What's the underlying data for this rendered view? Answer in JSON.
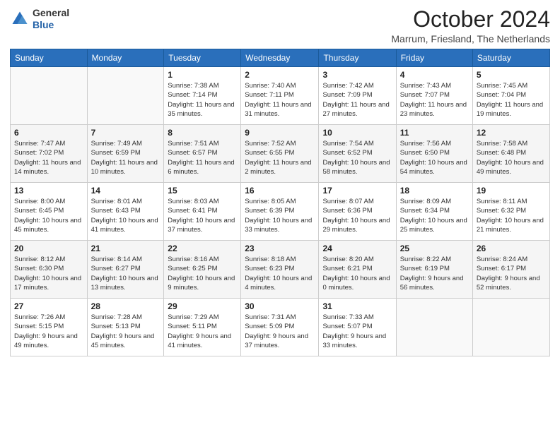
{
  "logo": {
    "general": "General",
    "blue": "Blue"
  },
  "header": {
    "month": "October 2024",
    "location": "Marrum, Friesland, The Netherlands"
  },
  "weekdays": [
    "Sunday",
    "Monday",
    "Tuesday",
    "Wednesday",
    "Thursday",
    "Friday",
    "Saturday"
  ],
  "weeks": [
    [
      {
        "day": "",
        "sunrise": "",
        "sunset": "",
        "daylight": ""
      },
      {
        "day": "",
        "sunrise": "",
        "sunset": "",
        "daylight": ""
      },
      {
        "day": "1",
        "sunrise": "Sunrise: 7:38 AM",
        "sunset": "Sunset: 7:14 PM",
        "daylight": "Daylight: 11 hours and 35 minutes."
      },
      {
        "day": "2",
        "sunrise": "Sunrise: 7:40 AM",
        "sunset": "Sunset: 7:11 PM",
        "daylight": "Daylight: 11 hours and 31 minutes."
      },
      {
        "day": "3",
        "sunrise": "Sunrise: 7:42 AM",
        "sunset": "Sunset: 7:09 PM",
        "daylight": "Daylight: 11 hours and 27 minutes."
      },
      {
        "day": "4",
        "sunrise": "Sunrise: 7:43 AM",
        "sunset": "Sunset: 7:07 PM",
        "daylight": "Daylight: 11 hours and 23 minutes."
      },
      {
        "day": "5",
        "sunrise": "Sunrise: 7:45 AM",
        "sunset": "Sunset: 7:04 PM",
        "daylight": "Daylight: 11 hours and 19 minutes."
      }
    ],
    [
      {
        "day": "6",
        "sunrise": "Sunrise: 7:47 AM",
        "sunset": "Sunset: 7:02 PM",
        "daylight": "Daylight: 11 hours and 14 minutes."
      },
      {
        "day": "7",
        "sunrise": "Sunrise: 7:49 AM",
        "sunset": "Sunset: 6:59 PM",
        "daylight": "Daylight: 11 hours and 10 minutes."
      },
      {
        "day": "8",
        "sunrise": "Sunrise: 7:51 AM",
        "sunset": "Sunset: 6:57 PM",
        "daylight": "Daylight: 11 hours and 6 minutes."
      },
      {
        "day": "9",
        "sunrise": "Sunrise: 7:52 AM",
        "sunset": "Sunset: 6:55 PM",
        "daylight": "Daylight: 11 hours and 2 minutes."
      },
      {
        "day": "10",
        "sunrise": "Sunrise: 7:54 AM",
        "sunset": "Sunset: 6:52 PM",
        "daylight": "Daylight: 10 hours and 58 minutes."
      },
      {
        "day": "11",
        "sunrise": "Sunrise: 7:56 AM",
        "sunset": "Sunset: 6:50 PM",
        "daylight": "Daylight: 10 hours and 54 minutes."
      },
      {
        "day": "12",
        "sunrise": "Sunrise: 7:58 AM",
        "sunset": "Sunset: 6:48 PM",
        "daylight": "Daylight: 10 hours and 49 minutes."
      }
    ],
    [
      {
        "day": "13",
        "sunrise": "Sunrise: 8:00 AM",
        "sunset": "Sunset: 6:45 PM",
        "daylight": "Daylight: 10 hours and 45 minutes."
      },
      {
        "day": "14",
        "sunrise": "Sunrise: 8:01 AM",
        "sunset": "Sunset: 6:43 PM",
        "daylight": "Daylight: 10 hours and 41 minutes."
      },
      {
        "day": "15",
        "sunrise": "Sunrise: 8:03 AM",
        "sunset": "Sunset: 6:41 PM",
        "daylight": "Daylight: 10 hours and 37 minutes."
      },
      {
        "day": "16",
        "sunrise": "Sunrise: 8:05 AM",
        "sunset": "Sunset: 6:39 PM",
        "daylight": "Daylight: 10 hours and 33 minutes."
      },
      {
        "day": "17",
        "sunrise": "Sunrise: 8:07 AM",
        "sunset": "Sunset: 6:36 PM",
        "daylight": "Daylight: 10 hours and 29 minutes."
      },
      {
        "day": "18",
        "sunrise": "Sunrise: 8:09 AM",
        "sunset": "Sunset: 6:34 PM",
        "daylight": "Daylight: 10 hours and 25 minutes."
      },
      {
        "day": "19",
        "sunrise": "Sunrise: 8:11 AM",
        "sunset": "Sunset: 6:32 PM",
        "daylight": "Daylight: 10 hours and 21 minutes."
      }
    ],
    [
      {
        "day": "20",
        "sunrise": "Sunrise: 8:12 AM",
        "sunset": "Sunset: 6:30 PM",
        "daylight": "Daylight: 10 hours and 17 minutes."
      },
      {
        "day": "21",
        "sunrise": "Sunrise: 8:14 AM",
        "sunset": "Sunset: 6:27 PM",
        "daylight": "Daylight: 10 hours and 13 minutes."
      },
      {
        "day": "22",
        "sunrise": "Sunrise: 8:16 AM",
        "sunset": "Sunset: 6:25 PM",
        "daylight": "Daylight: 10 hours and 9 minutes."
      },
      {
        "day": "23",
        "sunrise": "Sunrise: 8:18 AM",
        "sunset": "Sunset: 6:23 PM",
        "daylight": "Daylight: 10 hours and 4 minutes."
      },
      {
        "day": "24",
        "sunrise": "Sunrise: 8:20 AM",
        "sunset": "Sunset: 6:21 PM",
        "daylight": "Daylight: 10 hours and 0 minutes."
      },
      {
        "day": "25",
        "sunrise": "Sunrise: 8:22 AM",
        "sunset": "Sunset: 6:19 PM",
        "daylight": "Daylight: 9 hours and 56 minutes."
      },
      {
        "day": "26",
        "sunrise": "Sunrise: 8:24 AM",
        "sunset": "Sunset: 6:17 PM",
        "daylight": "Daylight: 9 hours and 52 minutes."
      }
    ],
    [
      {
        "day": "27",
        "sunrise": "Sunrise: 7:26 AM",
        "sunset": "Sunset: 5:15 PM",
        "daylight": "Daylight: 9 hours and 49 minutes."
      },
      {
        "day": "28",
        "sunrise": "Sunrise: 7:28 AM",
        "sunset": "Sunset: 5:13 PM",
        "daylight": "Daylight: 9 hours and 45 minutes."
      },
      {
        "day": "29",
        "sunrise": "Sunrise: 7:29 AM",
        "sunset": "Sunset: 5:11 PM",
        "daylight": "Daylight: 9 hours and 41 minutes."
      },
      {
        "day": "30",
        "sunrise": "Sunrise: 7:31 AM",
        "sunset": "Sunset: 5:09 PM",
        "daylight": "Daylight: 9 hours and 37 minutes."
      },
      {
        "day": "31",
        "sunrise": "Sunrise: 7:33 AM",
        "sunset": "Sunset: 5:07 PM",
        "daylight": "Daylight: 9 hours and 33 minutes."
      },
      {
        "day": "",
        "sunrise": "",
        "sunset": "",
        "daylight": ""
      },
      {
        "day": "",
        "sunrise": "",
        "sunset": "",
        "daylight": ""
      }
    ]
  ]
}
